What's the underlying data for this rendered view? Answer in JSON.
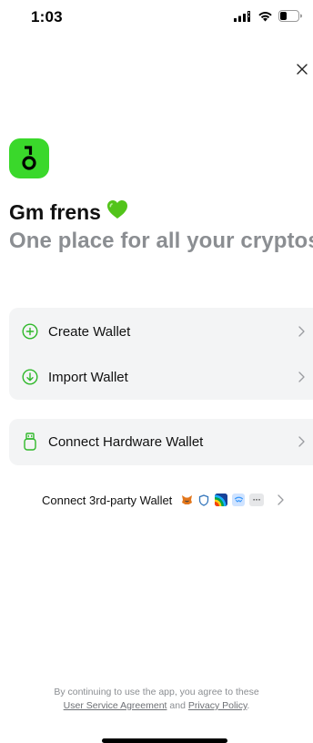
{
  "status_bar": {
    "time": "1:03"
  },
  "icons": {
    "close": "close-icon",
    "logo": "app-logo",
    "create": "plus-circle-icon",
    "import": "arrow-down-circle-icon",
    "hardware": "usb-device-icon",
    "chevron": "chevron-right-icon"
  },
  "header": {
    "greeting": "Gm frens",
    "greeting_emoji": "💚",
    "tagline": "One place for all your cryptos."
  },
  "actions": {
    "create_wallet": "Create Wallet",
    "import_wallet": "Import Wallet",
    "connect_hardware": "Connect Hardware Wallet"
  },
  "third_party": {
    "label": "Connect 3rd-party Wallet",
    "wallet_icons": [
      "metamask-icon",
      "shield-wallet-icon",
      "rainbow-wallet-icon",
      "walletconnect-icon",
      "more-icon"
    ],
    "more": "···"
  },
  "legal": {
    "prefix": "By continuing to use the app, you agree to these",
    "user_agreement": "User Service Agreement",
    "and": "and",
    "privacy_policy": "Privacy Policy",
    "suffix": "."
  },
  "colors": {
    "brand_green": "#3ad82b",
    "icon_green": "#2fb82a",
    "muted_text": "#8b8e92",
    "card_bg": "#f3f4f5"
  }
}
